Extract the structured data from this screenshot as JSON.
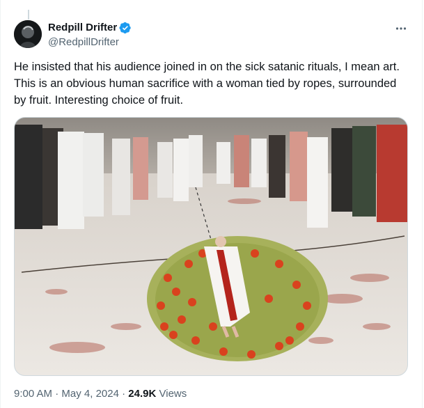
{
  "tweet": {
    "author": {
      "display_name": "Redpill Drifter",
      "handle": "@RedpillDrifter",
      "verified": true,
      "verified_icon": "verified-badge-icon",
      "avatar_icon": "avatar-dark-figure"
    },
    "more_icon": "more-ellipsis-icon",
    "text": "He insisted that his audience joined in on the sick satanic rituals, I mean art. This is an obvious human sacrifice with a woman tied by ropes, surrounded by fruit. Interesting choice of fruit.",
    "media": {
      "type": "photo",
      "alt": ""
    },
    "time": "9:00 AM",
    "separator": "·",
    "date": "May 4, 2024",
    "views_count": "24.9K",
    "views_label": "Views"
  },
  "colors": {
    "accent": "#1d9bf0",
    "text_primary": "#0f1419",
    "text_secondary": "#536471",
    "border": "#cfd9de"
  }
}
